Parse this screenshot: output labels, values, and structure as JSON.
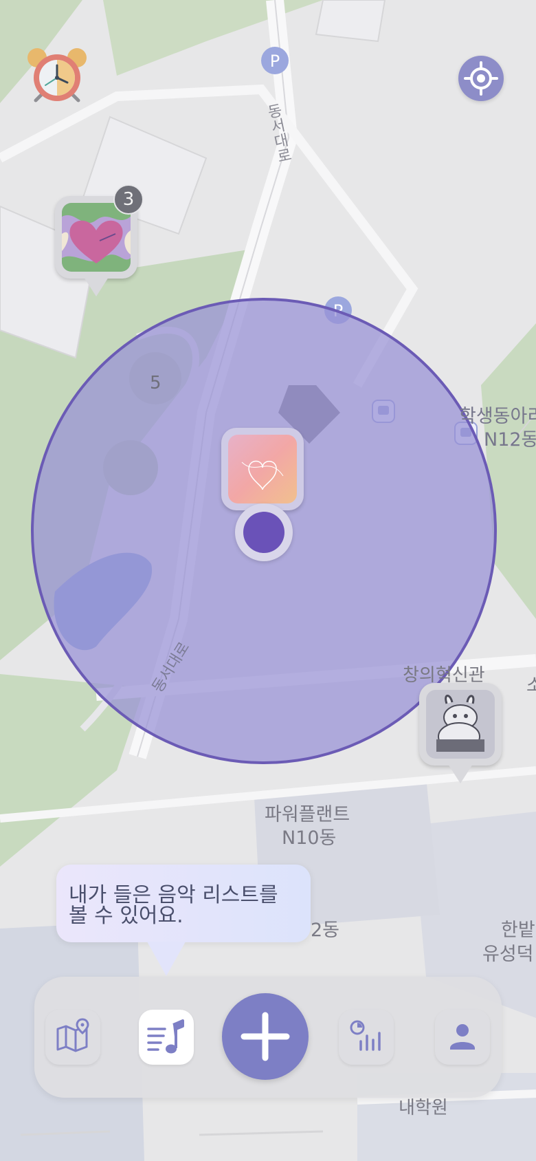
{
  "map": {
    "labels": {
      "road_top": "동서대로",
      "road_bottom": "동서대로",
      "pond_number": "5",
      "building_student_1": "학생동아리",
      "building_student_2": "N12동",
      "building_innovation": "창의혁신관",
      "building_power_1": "파워플랜트",
      "building_power_2": "N10동",
      "building_partial_dong": "2동",
      "building_hanbat_1": "한밭",
      "building_hanbat_2": "유성덕",
      "building_bottom": "내학원",
      "building_edge_right": "소"
    },
    "icons": [
      "parking-icon",
      "parking-icon",
      "bus-stop-icon",
      "bus-stop-icon"
    ]
  },
  "pins": {
    "cluster_count": "3"
  },
  "tooltip": {
    "line1": "내가 들은 음악 리스트를",
    "line2": "볼 수 있어요."
  },
  "nav": {
    "active": "music-list",
    "items": [
      "map-icon",
      "music-list-icon",
      "add-icon",
      "stats-icon",
      "profile-icon"
    ]
  },
  "colors": {
    "accent": "#7d7fc5",
    "circle_fill": "#9b96d9",
    "circle_stroke": "#6b5bb5"
  }
}
